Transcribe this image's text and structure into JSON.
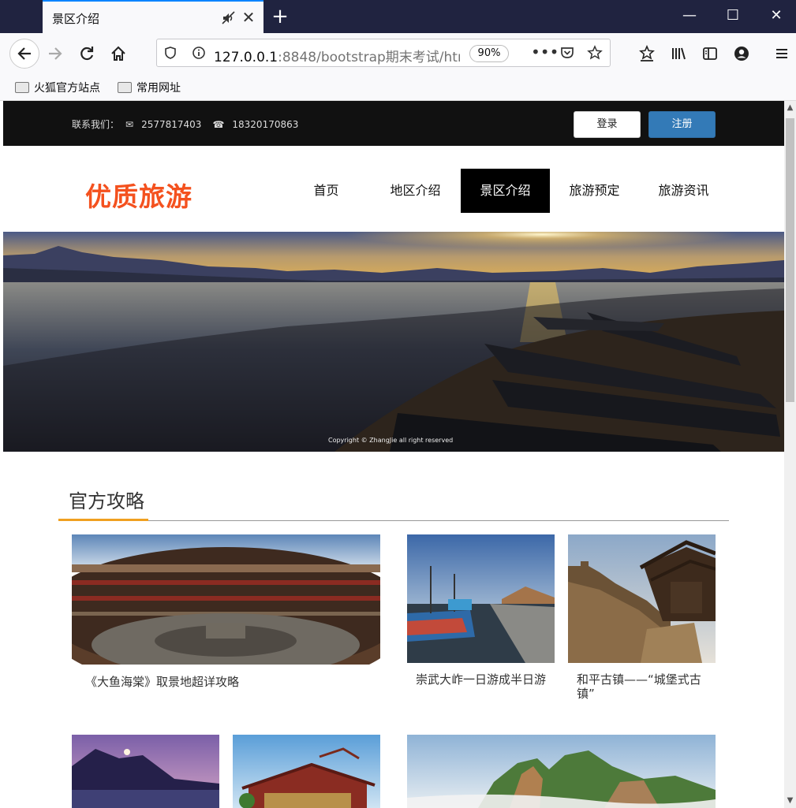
{
  "browser": {
    "tab_title": "景区介绍",
    "url_host": "127.0.0.1",
    "url_rest": ":8848/bootstrap期末考试/htm",
    "zoom": "90%",
    "bookmarks": [
      "火狐官方站点",
      "常用网址"
    ]
  },
  "topbar": {
    "contact_label": "联系我们：",
    "email": "2577817403",
    "phone": "18320170863",
    "login": "登录",
    "register": "注册"
  },
  "header": {
    "logo": "优质旅游",
    "menu": [
      "首页",
      "地区介绍",
      "景区介绍",
      "旅游预定",
      "旅游资讯"
    ],
    "active_index": 2
  },
  "banner": {
    "copyright": "Copyright © ZhangJie all right reserved"
  },
  "section": {
    "title": "官方攻略",
    "cards": [
      {
        "caption": "《大鱼海棠》取景地超详攻略"
      },
      {
        "caption": "崇武大岞一日游成半日游"
      },
      {
        "caption": "和平古镇——“城堡式古镇”"
      }
    ]
  },
  "colors": {
    "brand": "#f4511e",
    "register_button": "#337ab7",
    "accent_underline": "#f0a020",
    "topbar_bg": "#111111"
  }
}
